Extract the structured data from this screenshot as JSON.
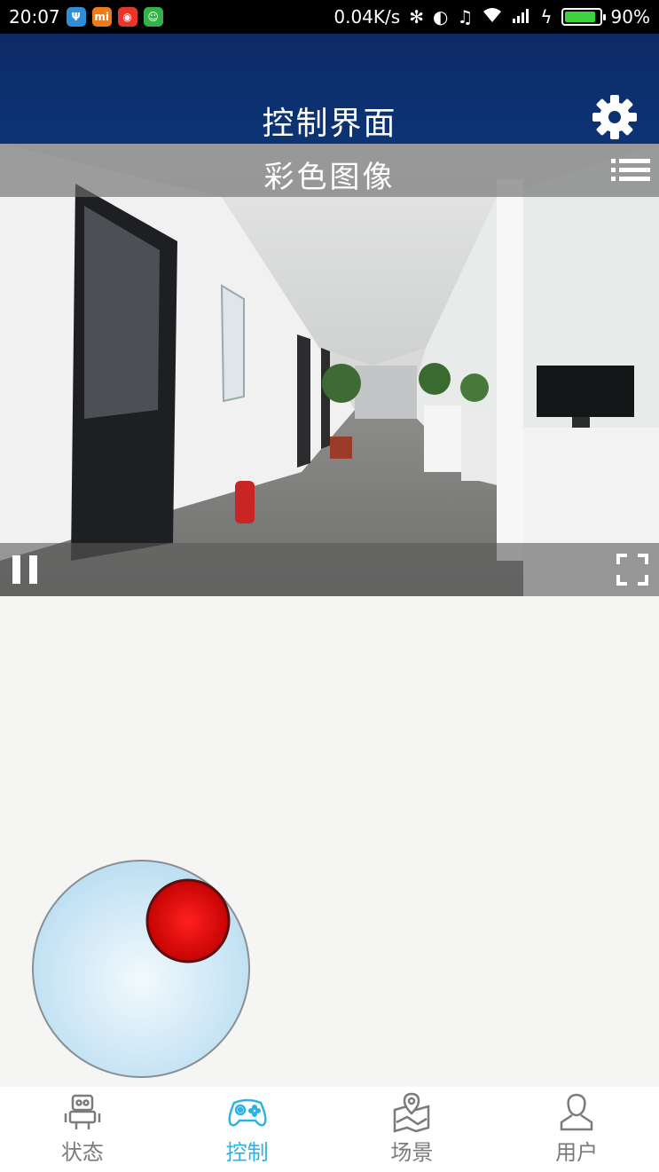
{
  "status_bar": {
    "time": "20:07",
    "notification_icons": [
      "usb-icon",
      "mi-icon",
      "weibo-icon",
      "android-icon"
    ],
    "speed": "0.04K/s",
    "battery": "90%",
    "battery_level": 0.9
  },
  "header": {
    "title": "控制界面",
    "settings_icon": "gear-icon"
  },
  "video": {
    "title": "彩色图像",
    "menu_icon": "list-icon",
    "pause_icon": "pause-icon",
    "fullscreen_icon": "fullscreen-icon"
  },
  "joystick": {
    "knob_color": "#e01010",
    "base_color": "#c8e3f3"
  },
  "bottom_nav": {
    "items": [
      {
        "label": "状态",
        "icon": "robot-icon",
        "active": false
      },
      {
        "label": "控制",
        "icon": "gamepad-icon",
        "active": true
      },
      {
        "label": "场景",
        "icon": "map-icon",
        "active": false
      },
      {
        "label": "用户",
        "icon": "user-icon",
        "active": false
      }
    ],
    "active_color": "#2bb3e6",
    "inactive_color": "#7b7b7b"
  },
  "colors": {
    "header_bg": "#0c2f6e",
    "page_bg": "#f5f6f4"
  }
}
